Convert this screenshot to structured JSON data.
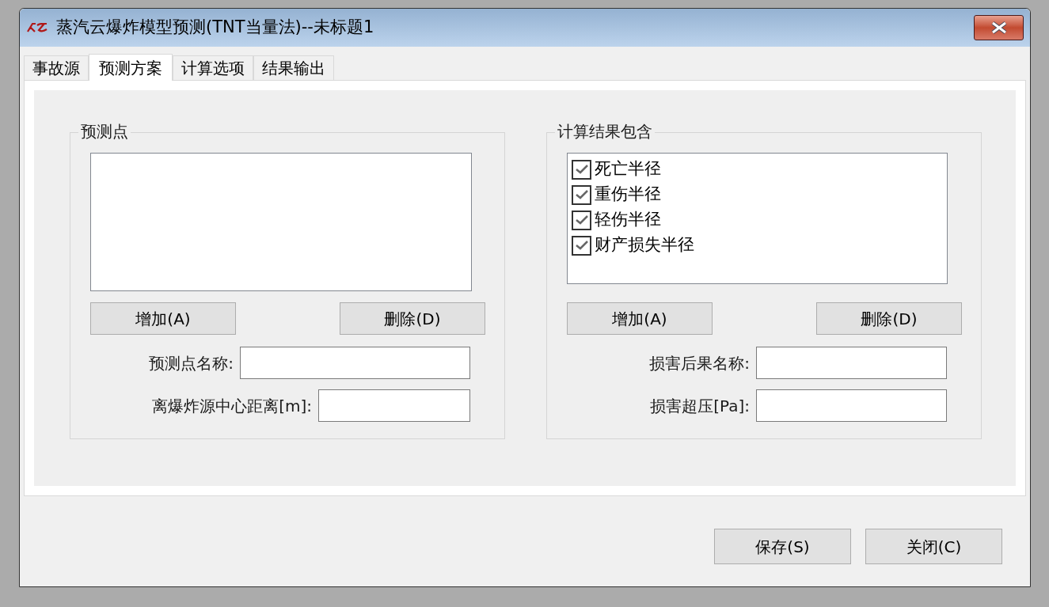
{
  "window": {
    "title": "蒸汽云爆炸模型预测(TNT当量法)--未标题1"
  },
  "tabs": [
    {
      "label": "事故源",
      "selected": false
    },
    {
      "label": "预测方案",
      "selected": true
    },
    {
      "label": "计算选项",
      "selected": false
    },
    {
      "label": "结果输出",
      "selected": false
    }
  ],
  "prediction_points": {
    "title": "预测点",
    "add_button": "增加(A)",
    "delete_button": "删除(D)",
    "fields": [
      {
        "label": "预测点名称:"
      },
      {
        "label": "离爆炸源中心距离[m]:"
      }
    ]
  },
  "results": {
    "title": "计算结果包含",
    "items": [
      {
        "label": "死亡半径",
        "checked": true
      },
      {
        "label": "重伤半径",
        "checked": true
      },
      {
        "label": "轻伤半径",
        "checked": true
      },
      {
        "label": "财产损失半径",
        "checked": true
      }
    ],
    "add_button": "增加(A)",
    "delete_button": "删除(D)",
    "fields": [
      {
        "label": "损害后果名称:"
      },
      {
        "label": "损害超压[Pa]:"
      }
    ]
  },
  "buttons": [
    "保存(S)",
    "关闭(C)"
  ]
}
